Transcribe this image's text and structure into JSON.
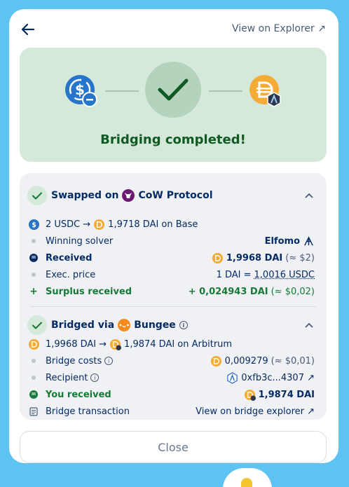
{
  "header": {
    "back_label": "←",
    "explorer_link": "View on Explorer ↗"
  },
  "hero": {
    "status_title": "Bridging completed!"
  },
  "swap": {
    "title_prefix": "Swapped on",
    "protocol": "CoW Protocol",
    "summary_from": "2 USDC",
    "summary_to": "1,9718 DAI on Base",
    "rows": {
      "solver_label": "Winning solver",
      "solver_value": "Elfomo",
      "received_label": "Received",
      "received_value": "1,9968 DAI",
      "received_fiat": "(≈ $2)",
      "price_label": "Exec. price",
      "price_value_prefix": "1 DAI = ",
      "price_value_rate": "1,0016 USDC",
      "surplus_label": "Surplus received",
      "surplus_value": "+ 0,024943 DAI",
      "surplus_fiat": "(≈ $0,02)"
    }
  },
  "bridge": {
    "title_prefix": "Bridged via",
    "protocol": "Bungee",
    "summary_from": "1,9968 DAI",
    "summary_to": "1,9874 DAI on Arbitrum",
    "rows": {
      "costs_label": "Bridge costs",
      "costs_value": "0,009279",
      "costs_fiat": "(≈ $0,01)",
      "recipient_label": "Recipient",
      "recipient_value": "0xfb3c...4307 ↗",
      "received_label": "You received",
      "received_value": "1,9874 DAI",
      "tx_label": "Bridge transaction",
      "tx_link": "View on bridge explorer ↗"
    }
  },
  "footer": {
    "close_label": "Close"
  },
  "colors": {
    "success": "#177a37",
    "navy": "#052b65",
    "hero_bg": "#d5e9da",
    "dai": "#f5ac37",
    "usdc": "#2775ca"
  }
}
